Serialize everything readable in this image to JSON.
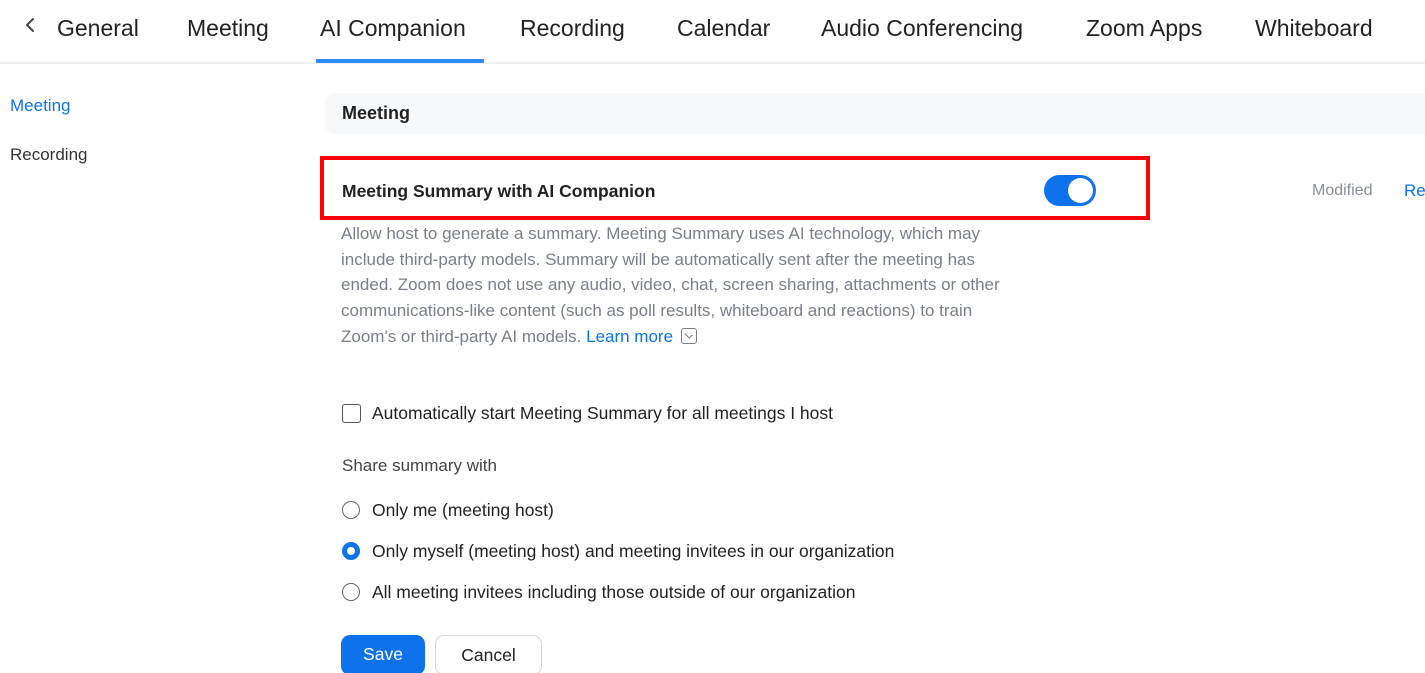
{
  "tabs": [
    {
      "label": "General"
    },
    {
      "label": "Meeting"
    },
    {
      "label": "AI Companion",
      "active": true
    },
    {
      "label": "Recording"
    },
    {
      "label": "Calendar"
    },
    {
      "label": "Audio Conferencing"
    },
    {
      "label": "Zoom Apps"
    },
    {
      "label": "Whiteboard"
    }
  ],
  "leftnav": {
    "items": [
      {
        "label": "Meeting",
        "active": true
      },
      {
        "label": "Recording",
        "active": false
      }
    ]
  },
  "section": {
    "title": "Meeting"
  },
  "setting": {
    "title": "Meeting Summary with AI Companion",
    "toggle_on": true,
    "modified_label": "Modified",
    "reset_label": "Re",
    "description": "Allow host to generate a summary. Meeting Summary uses AI technology, which may include third-party models. Summary will be automatically sent after the meeting has ended. Zoom does not use any audio, video, chat, screen sharing, attachments or other communications-like content (such as poll results, whiteboard and reactions) to train Zoom's or third-party AI models.",
    "learn_more": "Learn more",
    "auto_start_label": "Automatically start Meeting Summary for all meetings I host",
    "auto_start_checked": false,
    "share_label": "Share summary with",
    "share_options": [
      {
        "label": "Only me (meeting host)",
        "selected": false
      },
      {
        "label": "Only myself (meeting host) and meeting invitees in our organization",
        "selected": true
      },
      {
        "label": "All meeting invitees including those outside of our organization",
        "selected": false
      }
    ],
    "save_label": "Save",
    "cancel_label": "Cancel"
  },
  "colors": {
    "accent": "#0e72ed",
    "highlight": "#ff0000",
    "muted_text": "#7a7f87"
  }
}
